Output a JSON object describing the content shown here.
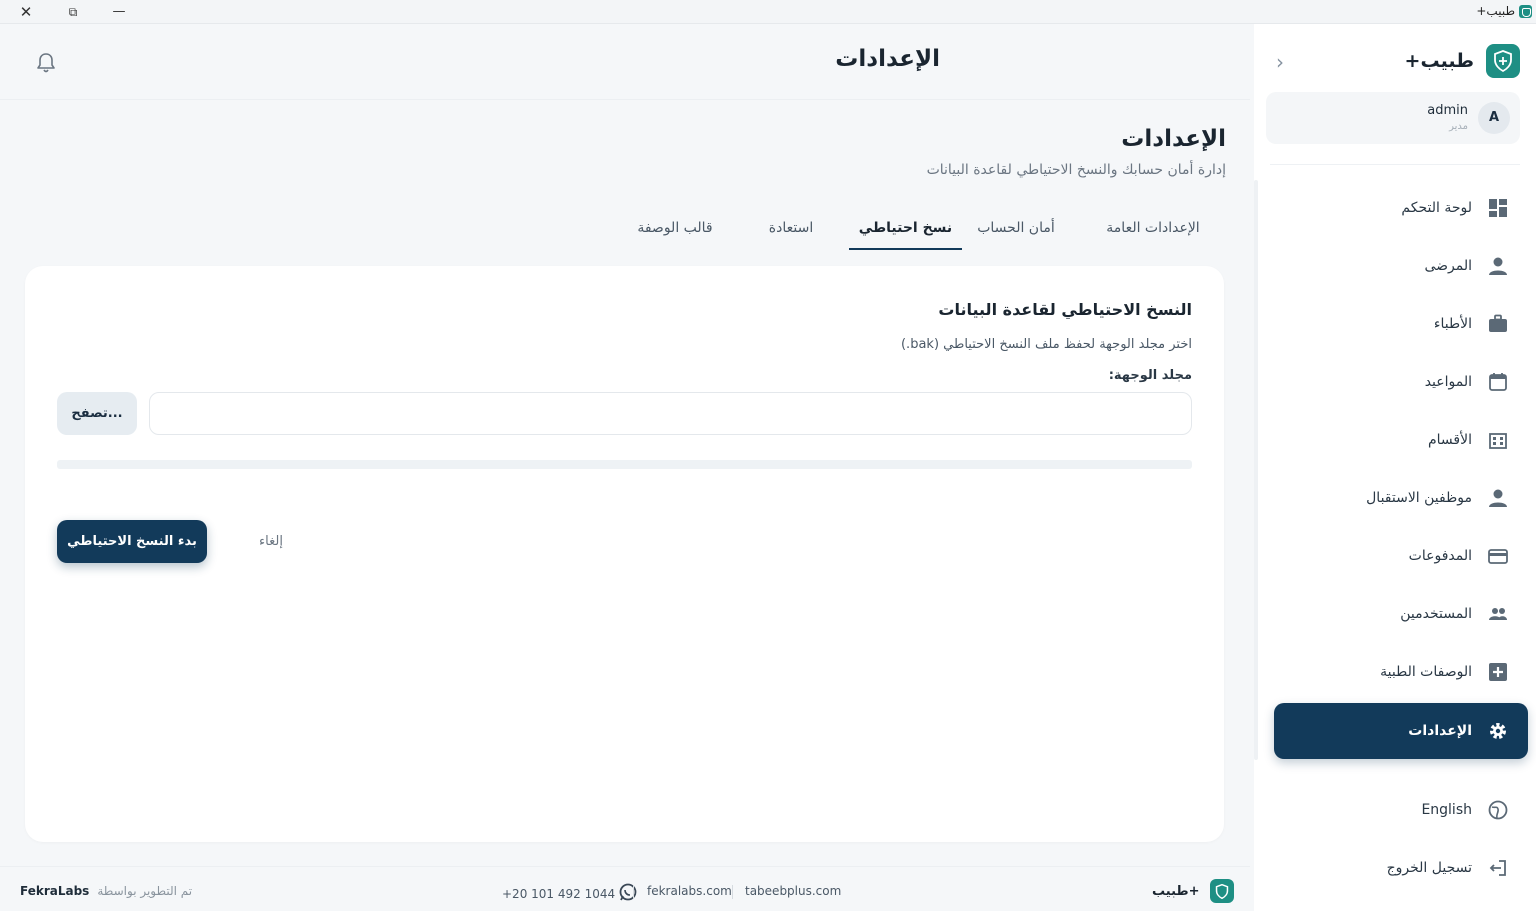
{
  "window": {
    "title": "طبيب+"
  },
  "colors": {
    "primary": "#123a5a",
    "brand": "#1e8f84",
    "background": "#f5f7f9"
  },
  "sidebar": {
    "brand_name": "طبيب+",
    "user": {
      "initial": "A",
      "name": "admin",
      "role": "مدير"
    },
    "items": [
      {
        "label": "لوحة التحكم",
        "icon": "dashboard-icon"
      },
      {
        "label": "المرضى",
        "icon": "person-icon"
      },
      {
        "label": "الأطباء",
        "icon": "briefcase-icon"
      },
      {
        "label": "المواعيد",
        "icon": "calendar-icon"
      },
      {
        "label": "الأقسام",
        "icon": "building-icon"
      },
      {
        "label": "موظفين الاستقبال",
        "icon": "person-icon"
      },
      {
        "label": "المدفوعات",
        "icon": "credit-card-icon"
      },
      {
        "label": "المستخدمين",
        "icon": "users-icon"
      },
      {
        "label": "الوصفات الطبية",
        "icon": "medical-plus-icon"
      },
      {
        "label": "الإعدادات",
        "icon": "gear-icon",
        "active": true
      }
    ],
    "language": "English",
    "logout": "تسجيل الخروج"
  },
  "header": {
    "title": "الإعدادات"
  },
  "page": {
    "title": "الإعدادات",
    "subtitle": "إدارة أمان حسابك والنسخ الاحتياطي لقاعدة البيانات"
  },
  "tabs": [
    {
      "label": "الإعدادات العامة"
    },
    {
      "label": "أمان الحساب"
    },
    {
      "label": "نسخ احتياطي",
      "active": true
    },
    {
      "label": "استعادة"
    },
    {
      "label": "قالب الوصفة"
    }
  ],
  "backup": {
    "title": "النسخ الاحتياطي لقاعدة البيانات",
    "description": "اختر مجلد الوجهة لحفظ ملف النسخ الاحتياطي (bak.)",
    "folder_label": "مجلد الوجهة:",
    "folder_value": "",
    "browse_label": "تصفح...",
    "progress": 0,
    "start_label": "بدء النسخ الاحتياطي",
    "cancel_label": "إلغاء"
  },
  "footer": {
    "credit_text": "تم التطوير بواسطة",
    "credit_company": "FekraLabs",
    "phone": "+20 101 492 1044",
    "link1": "fekralabs.com",
    "link2": "tabeebplus.com",
    "brand_name": "طبيب+"
  }
}
